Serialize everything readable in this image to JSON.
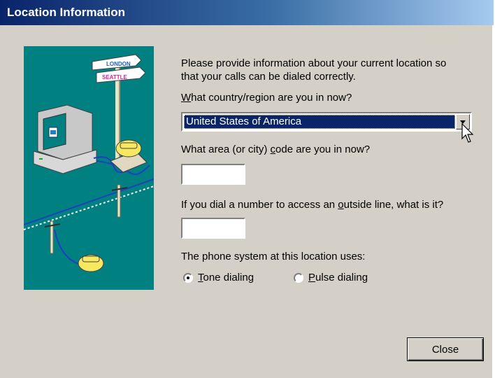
{
  "window": {
    "title": "Location Information"
  },
  "illustration": {
    "sign_top": "LONDON",
    "sign_bottom": "SEATTLE"
  },
  "intro_line1": "Please provide information about your current location so",
  "intro_line2": "that your calls can be dialed correctly.",
  "country": {
    "label_key": "W",
    "label_rest": "hat country/region are you in now?",
    "value": "United States of America"
  },
  "area_code": {
    "label_pre": "What area (or city) ",
    "label_key": "c",
    "label_post": "ode are you in now?",
    "value": ""
  },
  "outside_line": {
    "label_pre": "If you dial a number to access an ",
    "label_key": "o",
    "label_post": "utside line, what is it?",
    "value": ""
  },
  "phone_system": {
    "label": "The phone system at this location uses:",
    "tone": {
      "key": "T",
      "rest": "one dialing",
      "selected": true
    },
    "pulse": {
      "key": "P",
      "rest": "ulse dialing",
      "selected": false
    }
  },
  "buttons": {
    "close": "Close"
  }
}
